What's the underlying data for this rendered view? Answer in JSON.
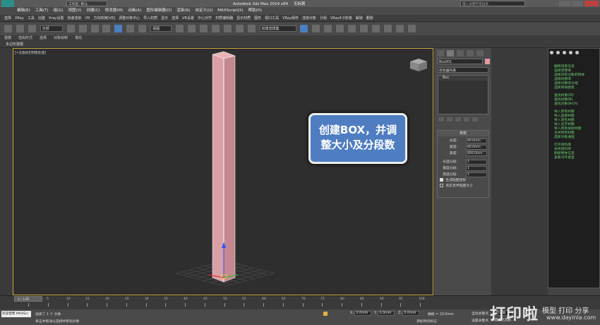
{
  "app": {
    "title": "Autodesk 3ds Max  2014 x64",
    "subtitle": "无标题",
    "workspace": "工作区: 默认",
    "search_placeholder": "键入关键字或短语"
  },
  "menu": [
    "编辑(E)",
    "工具(T)",
    "组(G)",
    "视图(V)",
    "创建(C)",
    "修改器(M)",
    "动画(A)",
    "图形编辑器(D)",
    "渲染(R)",
    "自定义(U)",
    "MAXScript(X)",
    "帮助(H)"
  ],
  "quickbar": [
    "选择",
    "VRay",
    "工具",
    "创建",
    "Vray设置",
    "快速渲染",
    "VR",
    "方向转换[VR]",
    "调整对象中心",
    "导入材质",
    "显示",
    "选择",
    "VR设置",
    "中心对齐",
    "材质编辑器",
    "显示材质",
    "图形",
    "视口工具",
    "VRay保存",
    "渲染对象",
    "分组",
    "VRay4.0安装",
    "解锁",
    "删除"
  ],
  "toolbar": {
    "select_filter": "全部",
    "view_dropdown": "视图",
    "selection_set": "创建选择集"
  },
  "ribbon": {
    "tabs": [
      "建模",
      "自由形式",
      "选择",
      "对象绘制",
      "填充"
    ],
    "sub_label": "多边形建模"
  },
  "viewport": {
    "label": "[+][透视][明暗处理]"
  },
  "callout": {
    "line1": "创建BOX，并调",
    "line2": "整大小及分段数"
  },
  "command_panel": {
    "object_name": "Box001",
    "modifier_list": "修改器列表",
    "stack_item": "Box",
    "rollout_title": "参数",
    "params": [
      {
        "label": "长度:",
        "value": "80.0mm"
      },
      {
        "label": "宽度:",
        "value": "80.0mm"
      },
      {
        "label": "高度:",
        "value": "800.0mm"
      }
    ],
    "segments": [
      {
        "label": "长度分段:",
        "value": "1"
      },
      {
        "label": "宽度分段:",
        "value": "1"
      },
      {
        "label": "高度分段:",
        "value": "1"
      }
    ],
    "checkbox1": "生成贴图坐标",
    "checkbox2": "真实世界贴图大小"
  },
  "scene_panel": {
    "links": [
      "翻转场景信息",
      "选择空物体",
      "选择没有对象的物体",
      "选择材质ID",
      "选择对象ID分组",
      "选择同样颜色",
      "查找材质(ID)",
      "查找材质(N)",
      "查找对象(Arch)",
      "导入所有材质",
      "导入选择材质",
      "导入同名材质",
      "导入名字材质",
      "导入所有发射材质",
      "合并所有材质",
      "选择对象通道",
      "打开资料库",
      "关闭资料库",
      "刷新物体信息",
      "查看对齐类型"
    ]
  },
  "timeline": {
    "frame_label": "0 / 100",
    "ticks": [
      "0",
      "5",
      "10",
      "15",
      "20",
      "25",
      "30",
      "35",
      "40",
      "45",
      "50",
      "55",
      "60",
      "65",
      "70",
      "75",
      "80",
      "85",
      "90",
      "95",
      "100"
    ]
  },
  "status": {
    "welcome": "欢迎使用 MAXScr",
    "selected": "选择了 1 个 对象",
    "hint": "单击并拖动以选择并移动对象",
    "x_label": "X:",
    "x_value": "0.0mm",
    "y_label": "Y:",
    "y_value": "0.0mm",
    "z_label": "Z:",
    "z_value": "0.0mm",
    "grid": "栅格 = 10.0mm",
    "autokey": "自动关键点",
    "selected_drop": "选定对象",
    "set_key": "设置关键点",
    "key_filter": "关键点过滤器...",
    "add_time": "添加时间标记"
  },
  "watermark": {
    "brand": "打印啦",
    "slogan": "模型 打印 分享",
    "url": "www.dayinla.com"
  }
}
